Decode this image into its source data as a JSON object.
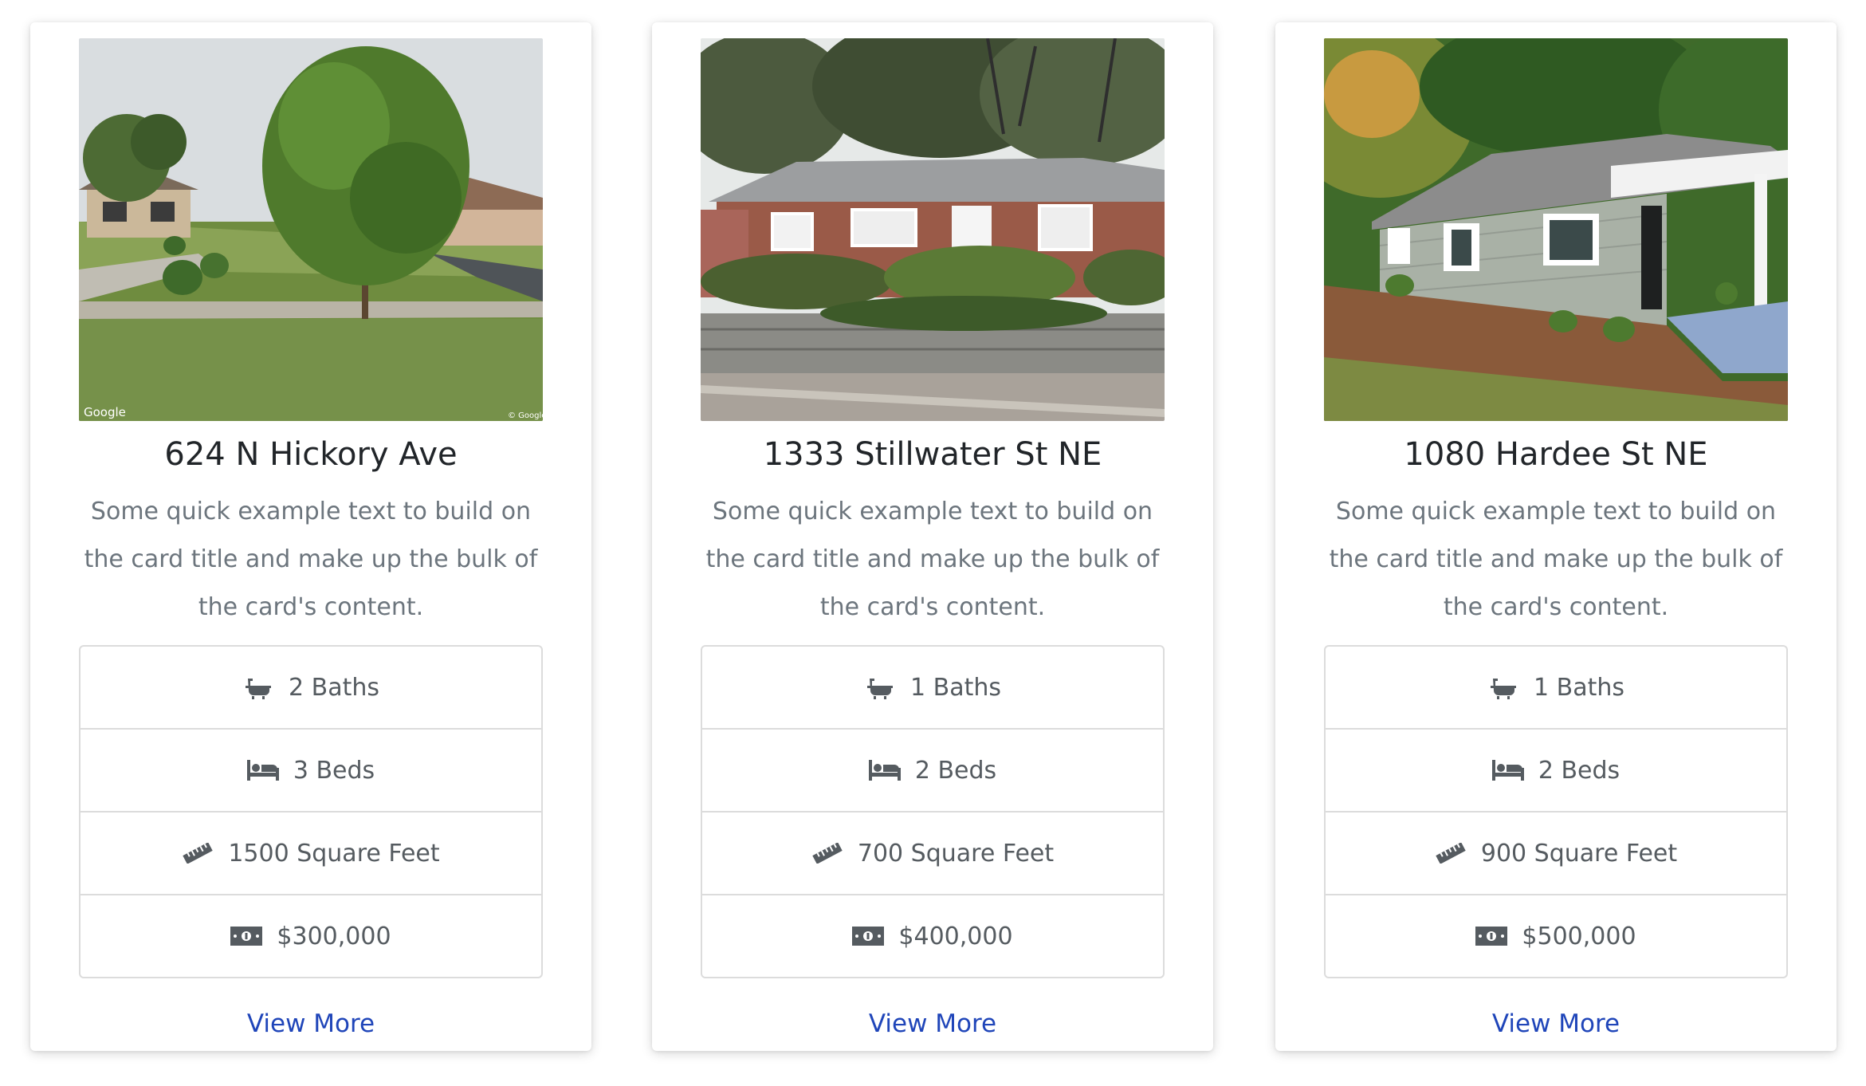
{
  "cards": [
    {
      "title": "624 N Hickory Ave",
      "text": "Some quick example text to build on the card title and make up the bulk of the card's content.",
      "baths": "2 Baths",
      "beds": "3 Beds",
      "area": "1500 Square Feet",
      "price": "$300,000",
      "link": "View More",
      "watermark_left": "Google",
      "watermark_right": "© Google"
    },
    {
      "title": "1333 Stillwater St NE",
      "text": "Some quick example text to build on the card title and make up the bulk of the card's content.",
      "baths": "1 Baths",
      "beds": "2 Beds",
      "area": "700 Square Feet",
      "price": "$400,000",
      "link": "View More"
    },
    {
      "title": "1080 Hardee St NE",
      "text": "Some quick example text to build on the card title and make up the bulk of the card's content.",
      "baths": "1 Baths",
      "beds": "2 Beds",
      "area": "900 Square Feet",
      "price": "$500,000",
      "link": "View More"
    }
  ],
  "icons": {
    "baths": "bath-icon",
    "beds": "bed-icon",
    "area": "ruler-icon",
    "price": "money-bill-icon"
  },
  "colors": {
    "link": "#1f45b9",
    "title": "#212529",
    "muted_text": "#6c757d",
    "icon": "#555b60",
    "border": "#dcdcdc"
  }
}
